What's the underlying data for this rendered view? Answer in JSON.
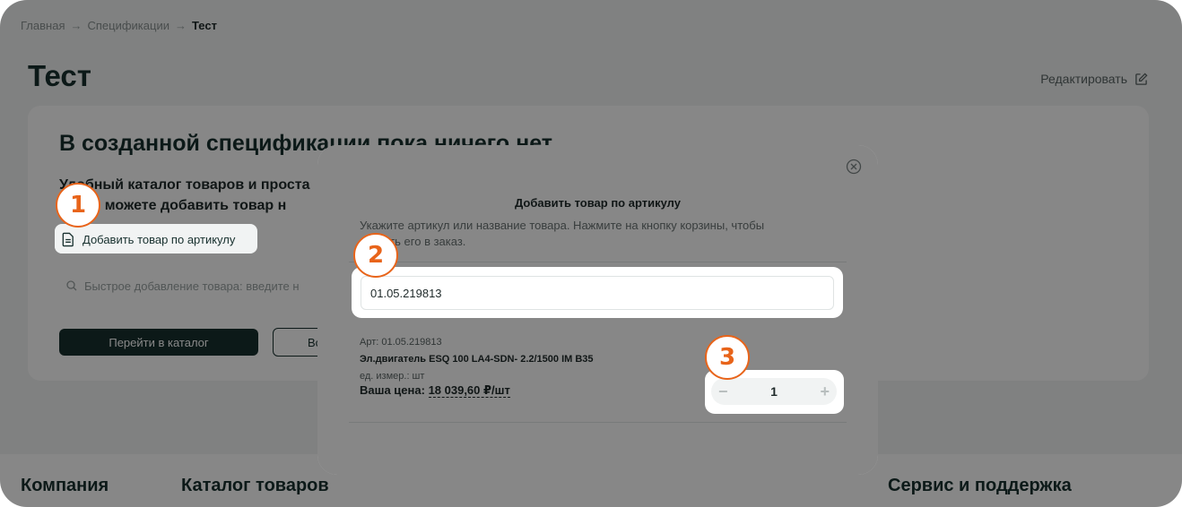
{
  "breadcrumb": {
    "home": "Главная",
    "specs": "Спецификации",
    "current": "Тест",
    "sep": "→"
  },
  "page": {
    "title": "Тест",
    "edit_label": "Редактировать"
  },
  "card": {
    "title": "В созданной спецификации пока ничего нет",
    "text_line1": "Удобный каталог товаров и проста",
    "text_line2": "Также можете добавить товар н",
    "add_by_article_label": "Добавить товар по артикулу",
    "quick_add_placeholder": "Быстрое добавление товара: введите н",
    "catalog_button": "Перейти в каталог",
    "second_button": "Вс"
  },
  "footer": {
    "company": "Компания",
    "catalog": "Каталог товаров",
    "support": "Сервис и поддержка"
  },
  "modal": {
    "title": "Добавить товар по артикулу",
    "hint_line1": "Укажите артикул или название товара. Нажмите на кнопку корзины, чтобы",
    "hint_line2": "тить его в заказ.",
    "article_value": "01.05.219813",
    "product": {
      "article": "Арт: 01.05.219813",
      "name": "Эл.двигатель ESQ 100 LA4-SDN- 2.2/1500 IM B35",
      "unit": "ед. измер.: шт",
      "price_label": "Ваша цена:",
      "price_value": "18 039,60 ₽/шт"
    },
    "quantity": {
      "minus": "−",
      "value": "1",
      "plus": "+"
    }
  },
  "badges": [
    "1",
    "2",
    "3"
  ],
  "colors": {
    "accent": "#e8641a",
    "primary": "#17302e",
    "background": "#f2f3f3"
  }
}
